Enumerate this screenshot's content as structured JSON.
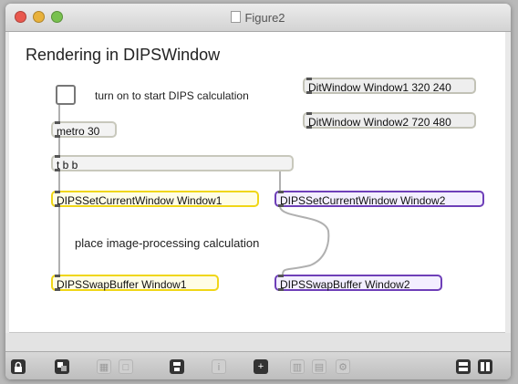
{
  "window": {
    "title": "Figure2"
  },
  "patcher": {
    "heading": "Rendering in DIPSWindow",
    "toggle_comment": "turn on to start DIPS calculation",
    "metro": "metro 30",
    "trigger": "t b b",
    "ditwindow1": "DitWindow Window1 320 240",
    "ditwindow2": "DitWindow Window2 720 480",
    "set_current_1": "DIPSSetCurrentWindow Window1",
    "set_current_2": "DIPSSetCurrentWindow Window2",
    "processing_comment": "place image-processing calculation",
    "swap_1": "DIPSSwapBuffer Window1",
    "swap_2": "DIPSSwapBuffer Window2"
  },
  "toolbar": {
    "items": [
      {
        "icon": "lock-icon",
        "state": "dark"
      },
      {
        "icon": "presentation-icon",
        "state": "dark"
      },
      {
        "icon": "grid-icon",
        "state": "dim"
      },
      {
        "icon": "new-object-icon",
        "state": "dim"
      },
      {
        "icon": "save-icon",
        "state": "dark"
      },
      {
        "icon": "info-icon",
        "state": "dim"
      },
      {
        "icon": "add-icon",
        "state": "dark"
      },
      {
        "icon": "keypad-icon",
        "state": "dim"
      },
      {
        "icon": "table-icon",
        "state": "dim"
      },
      {
        "icon": "settings-icon",
        "state": "dim"
      },
      {
        "icon": "split-horizontal-icon",
        "state": "dark"
      },
      {
        "icon": "split-vertical-icon",
        "state": "dark"
      }
    ]
  },
  "colors": {
    "yellow_border": "#f0d616",
    "purple_border": "#6e3fb8"
  }
}
